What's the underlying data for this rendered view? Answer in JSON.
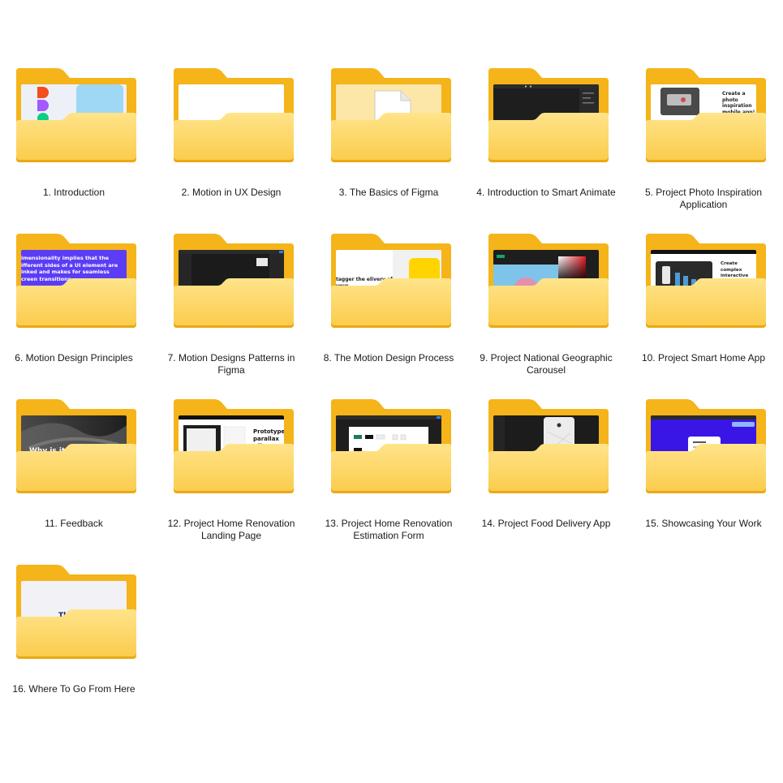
{
  "folders": [
    {
      "label": "1. Introduction",
      "preview": "figma-logo"
    },
    {
      "label": "2. Motion in UX Design",
      "preview": "blank-white"
    },
    {
      "label": "3. The Basics of Figma",
      "preview": "document"
    },
    {
      "label": "4. Introduction to Smart Animate",
      "preview": "dark-editor"
    },
    {
      "label": "5. Project Photo Inspiration Application",
      "preview": "photo-app",
      "preview_text": "Create a photo inspiration mobile app!"
    },
    {
      "label": "6. Motion Design Principles",
      "preview": "purple-text",
      "preview_text": "imensionality implies that the ifferent sides of a UI element are inked and makes for seamless creen transitions."
    },
    {
      "label": "7. Motion Designs Patterns in Figma",
      "preview": "dark-editor-2"
    },
    {
      "label": "8. The Motion Design Process",
      "preview": "stagger",
      "preview_text": "tagger the elivery of your"
    },
    {
      "label": "9. Project National Geographic Carousel",
      "preview": "color-picker"
    },
    {
      "label": "10. Project Smart Home App",
      "preview": "interactive",
      "preview_text": "Create complex interactive components!"
    },
    {
      "label": "11. Feedback",
      "preview": "photo-dark",
      "preview_text": "Why is it so i"
    },
    {
      "label": "12. Project Home Renovation Landing Page",
      "preview": "parallax",
      "preview_text": "Prototype parallax effects!"
    },
    {
      "label": "13. Project Home Renovation Estimation Form",
      "preview": "form-editor"
    },
    {
      "label": "14. Project Food Delivery App",
      "preview": "map-phone"
    },
    {
      "label": "15. Showcasing Your Work",
      "preview": "showcase"
    },
    {
      "label": "16. Where To Go From Here",
      "preview": "light-page",
      "preview_text": "Th"
    }
  ],
  "colors": {
    "folder_back": "#F4B41A",
    "folder_front_top": "#FFE48A",
    "folder_front_bottom": "#FBCB4A",
    "folder_edge": "#E9A916"
  }
}
